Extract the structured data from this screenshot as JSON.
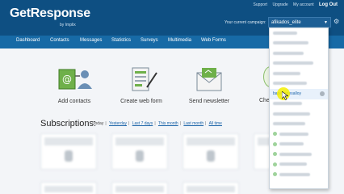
{
  "brand": {
    "name": "GetResponse",
    "sub": "by Implix"
  },
  "toplinks": [
    "Support",
    "Upgrade",
    "My account",
    "Log Out"
  ],
  "campaign": {
    "label": "Your current campaign:",
    "value": "afikados_elite"
  },
  "nav": [
    "Dashboard",
    "Contacts",
    "Messages",
    "Statistics",
    "Surveys",
    "Multimedia",
    "Web Forms"
  ],
  "actions": [
    {
      "label": "Add contacts",
      "icon": "add-contact-icon"
    },
    {
      "label": "Create web form",
      "icon": "web-form-icon"
    },
    {
      "label": "Send newsletter",
      "icon": "newsletter-icon"
    },
    {
      "label": "Chec",
      "icon": "check-icon"
    }
  ],
  "subscriptions": {
    "title": "Subscriptions:",
    "filters": [
      "Today",
      "Yesterday",
      "Last 7 days",
      "This month",
      "Last month",
      "All time"
    ]
  },
  "dropdown": {
    "highlighted": "bapedenesalloy",
    "colors": {
      "highlight": "#e8f1fb",
      "link": "#1a63a8",
      "header": "#0e4f82",
      "nav": "#176aa6"
    }
  }
}
